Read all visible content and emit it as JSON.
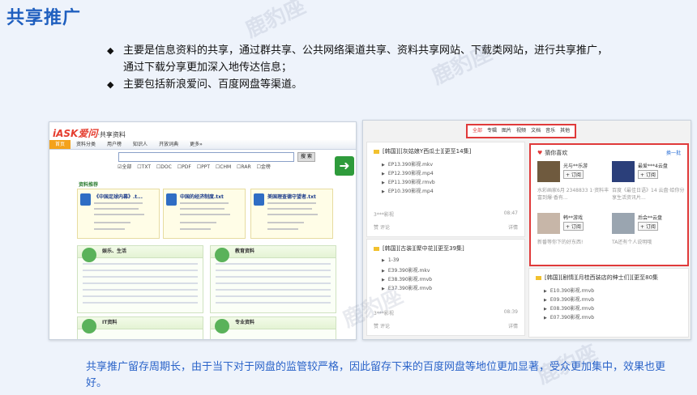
{
  "title": "共享推广",
  "bullets": [
    "主要是信息资料的共享，通过群共享、公共网络渠道共享、资料共享网站、下载类网站，进行共享推广，",
    "通过下载分享更加深入地传达信息；",
    "主要包括新浪爱问、百度网盘等渠道。"
  ],
  "footer": "共享推广留存周期长，由于当下对于网盘的监管较严格，因此留存下来的百度网盘等地位更加显著，受众更加集中，效果也更好。",
  "watermark": "鹿豹座",
  "iask": {
    "logo": "iASK爱问",
    "logo_sub": "·共享资料",
    "nav": [
      "首页",
      "资料分类",
      "用户榜",
      "知识人",
      "开放词典",
      "更多»"
    ],
    "search_btn": "搜 索",
    "options": "☑全部 ☐TXT ☐DOC ☐PDF ☐PPT ☐CHM ☐RAR ☐金榜",
    "recommend_title": "资料推荐",
    "rec_items": [
      "《中国足球内幕》.t...",
      "中国的经济制度.txt",
      "美国理查德守望者.txt"
    ],
    "sections": [
      "娱乐、生活",
      "教育资料",
      "IT资料",
      "专业资料"
    ]
  },
  "pan": {
    "tabs": [
      "全部",
      "专辑",
      "图片",
      "视频",
      "文档",
      "音乐",
      "其他"
    ],
    "card1_title": "[韩国][[灰姑娘Y西瓜士][更至14集]",
    "card1_files": [
      "EP13.390影视.mkv",
      "EP12.390影视.mp4",
      "EP11.390影视.rmvb",
      "EP10.390影视.mp4"
    ],
    "card1_user": "3***影视",
    "card1_time": "08:47",
    "card2_title": "[韩国][古装][聚中花][更至39集]",
    "card2_files": [
      "1-39",
      "E39.390影视.mkv",
      "E38.390影视.rmvb",
      "E37.390影视.rmvb"
    ],
    "card2_user": "3***影视",
    "card2_time": "08:39",
    "card3_title": "[韩国][剧情][月桂西装店的绅士们][更至80集",
    "card3_files": [
      "E10.390影视.rmvb",
      "E09.390影视.rmvb",
      "E08.390影视.rmvb",
      "E07.390影视.rmvb"
    ],
    "like": "赞",
    "comment": "评论",
    "detail": "详情",
    "guess_title": "猜你喜欢",
    "guess_more": "换一批",
    "follow": "+ 订阅",
    "users": [
      {
        "name": "光与**乐游",
        "desc": "水彩画家6月 2348833 1·资料丰富到爆·香有..."
      },
      {
        "name": "最爱***4云盘",
        "desc": "百度《最佳日语》14 云盘·给你分享生活资讯片..."
      },
      {
        "name": "韩**游戏",
        "desc": "新番等你下的好东西!"
      },
      {
        "name": "后会**云盘",
        "desc": "TA还有个人说明哦"
      }
    ]
  }
}
